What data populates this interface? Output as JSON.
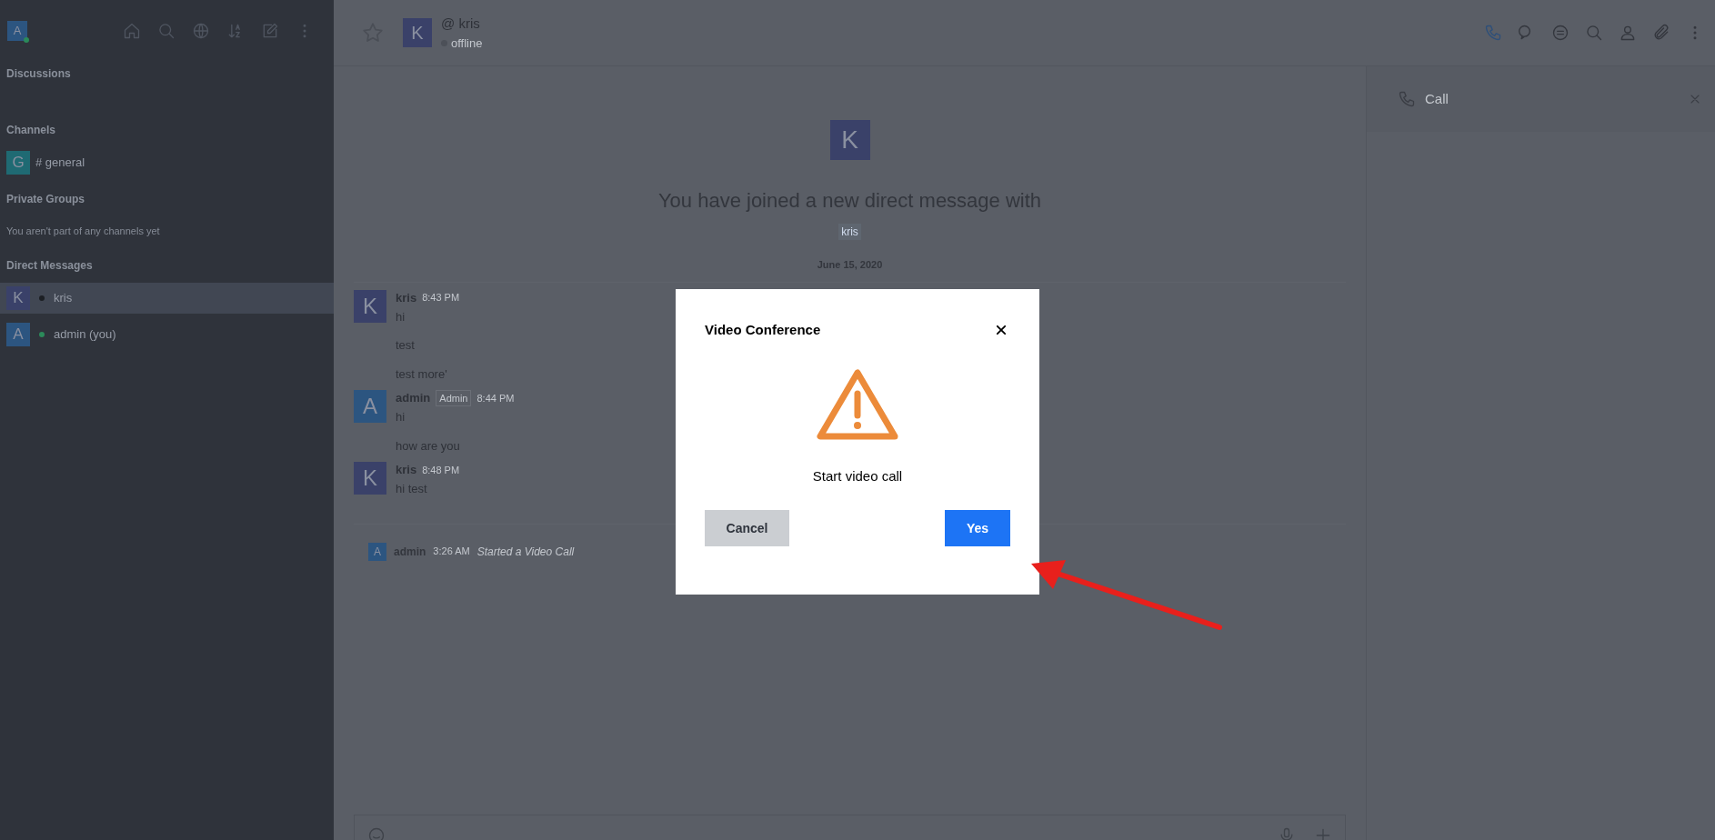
{
  "sidebar": {
    "user_avatar": {
      "letter": "A",
      "color": "#2c5580",
      "online": true
    },
    "sections": [
      {
        "title": "Discussions"
      },
      {
        "title": "Channels",
        "items": [
          {
            "letter": "G",
            "color": "#1f6a73",
            "prefix": "#",
            "label": "general",
            "selected": false
          }
        ]
      },
      {
        "title": "Private Groups",
        "empty_text": "You aren't part of any channels yet"
      },
      {
        "title": "Direct Messages",
        "items": [
          {
            "letter": "K",
            "color": "#3a4169",
            "online": false,
            "label": "kris",
            "selected": true
          },
          {
            "letter": "A",
            "color": "#2c5580",
            "online": true,
            "label": "admin (you)",
            "selected": false
          }
        ]
      }
    ]
  },
  "room_header": {
    "avatar": {
      "letter": "K",
      "color": "#3a4169"
    },
    "title": "@ kris",
    "status_text": "offline"
  },
  "intro": {
    "avatar": {
      "letter": "K",
      "color": "#3a4169"
    },
    "heading": "You have joined a new direct message with",
    "mention": "kris",
    "date": "June 15, 2020"
  },
  "messages": [
    {
      "author": "kris",
      "letter": "K",
      "color": "#3a4169",
      "time": "8:43 PM",
      "lines": [
        "hi",
        "test",
        "test more'"
      ]
    },
    {
      "author": "admin",
      "letter": "A",
      "color": "#2c5580",
      "role": "Admin",
      "time": "8:44 PM",
      "lines": [
        "hi",
        "how are you"
      ]
    },
    {
      "author": "kris",
      "letter": "K",
      "color": "#3a4169",
      "time": "8:48 PM",
      "lines": [
        "hi test"
      ]
    }
  ],
  "system_message": {
    "author": "admin",
    "letter": "A",
    "color": "#2c5580",
    "time": "3:26 AM",
    "text": "Started a Video Call"
  },
  "call_panel": {
    "title": "Call"
  },
  "dialog": {
    "title": "Video Conference",
    "message": "Start video call",
    "buttons": [
      {
        "kind": "cancel",
        "label": "Cancel"
      },
      {
        "kind": "confirm",
        "label": "Yes"
      }
    ]
  }
}
